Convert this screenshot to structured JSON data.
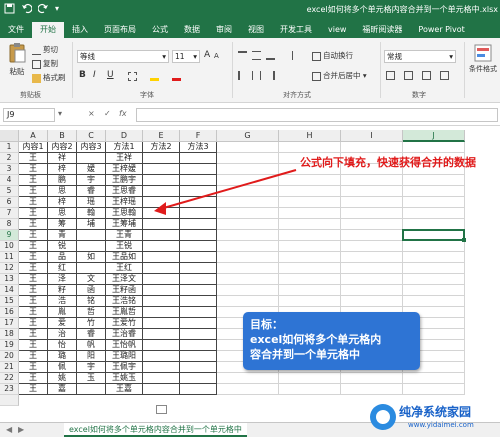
{
  "window": {
    "title": "excel如何将多个单元格内容合并到一个单元格中.xlsx",
    "save_icon": "save-icon",
    "undo_icon": "undo-icon",
    "redo_icon": "redo-icon"
  },
  "ribbon_tabs": [
    "文件",
    "开始",
    "插入",
    "页面布局",
    "公式",
    "数据",
    "审阅",
    "视图",
    "开发工具",
    "view",
    "福昕阅读器",
    "Power Pivot"
  ],
  "active_tab": "开始",
  "ribbon": {
    "clipboard": {
      "paste": "粘贴",
      "cut": "剪切",
      "copy": "复制",
      "format_painter": "格式刷",
      "label": "剪贴板"
    },
    "font": {
      "font_name": "等线",
      "font_size": "11",
      "grow": "A",
      "shrink": "A",
      "bold": "B",
      "italic": "I",
      "underline": "U",
      "label": "字体"
    },
    "alignment": {
      "wrap": "自动换行",
      "merge": "合并后居中",
      "label": "对齐方式"
    },
    "number": {
      "format": "常规",
      "label": "数字"
    },
    "styles": {
      "conditional": "条件格式"
    }
  },
  "formula_bar": {
    "name_box": "J9",
    "cancel": "×",
    "enter": "✓",
    "fx": "fx",
    "value": ""
  },
  "columns": [
    "A",
    "B",
    "C",
    "D",
    "E",
    "F",
    "G",
    "H",
    "I",
    "J"
  ],
  "selected_column": "J",
  "selected_row": "9",
  "rows": [
    [
      "1",
      "内容1",
      "内容2",
      "内容3",
      "方法1",
      "方法2",
      "方法3"
    ],
    [
      "2",
      "王",
      "祥",
      "",
      "王祥",
      "",
      ""
    ],
    [
      "3",
      "王",
      "梓",
      "嫒",
      "王梓嫒",
      "",
      ""
    ],
    [
      "4",
      "王",
      "鹏",
      "宇",
      "王鹏宇",
      "",
      ""
    ],
    [
      "5",
      "王",
      "思",
      "睿",
      "王思睿",
      "",
      ""
    ],
    [
      "6",
      "王",
      "梓",
      "瑶",
      "王梓瑶",
      "",
      ""
    ],
    [
      "7",
      "王",
      "思",
      "翰",
      "王思翰",
      "",
      ""
    ],
    [
      "8",
      "王",
      "筹",
      "埔",
      "王筹埔",
      "",
      ""
    ],
    [
      "9",
      "王",
      "青",
      "",
      "王青",
      "",
      ""
    ],
    [
      "10",
      "王",
      "锐",
      "",
      "王锐",
      "",
      ""
    ],
    [
      "11",
      "王",
      "品",
      "如",
      "王品如",
      "",
      ""
    ],
    [
      "12",
      "王",
      "红",
      "",
      "王红",
      "",
      ""
    ],
    [
      "13",
      "王",
      "泽",
      "文",
      "王泽文",
      "",
      ""
    ],
    [
      "14",
      "王",
      "籽",
      "函",
      "王籽函",
      "",
      ""
    ],
    [
      "15",
      "王",
      "浩",
      "铭",
      "王浩铭",
      "",
      ""
    ],
    [
      "16",
      "王",
      "胤",
      "哲",
      "王胤哲",
      "",
      ""
    ],
    [
      "17",
      "王",
      "爱",
      "竹",
      "王爱竹",
      "",
      ""
    ],
    [
      "18",
      "王",
      "治",
      "睿",
      "王治睿",
      "",
      ""
    ],
    [
      "19",
      "王",
      "怡",
      "帆",
      "王怡帆",
      "",
      ""
    ],
    [
      "20",
      "王",
      "璐",
      "阳",
      "王璐阳",
      "",
      ""
    ],
    [
      "21",
      "王",
      "佩",
      "宇",
      "王佩宇",
      "",
      ""
    ],
    [
      "22",
      "王",
      "姚",
      "玉",
      "王姚玉",
      "",
      ""
    ],
    [
      "23",
      "王",
      "嘉",
      "",
      "王嘉",
      "",
      ""
    ]
  ],
  "annotation_red": "公式向下填充，快速获得合并的数据",
  "blue_box": {
    "line1": "目标：",
    "line2": "excel如何将多个单元格内",
    "line3": "容合并到一个单元格中"
  },
  "sheet_tab": "excel如何将多个单元格内容合并到一个单元格中",
  "watermark": {
    "title": "纯净系统家园",
    "url": "www.yidaimei.com"
  },
  "colors": {
    "excel_green": "#217346",
    "annotation_red": "#e01b1b",
    "box_blue": "#2e74d4",
    "watermark_blue": "#1a63c9"
  }
}
